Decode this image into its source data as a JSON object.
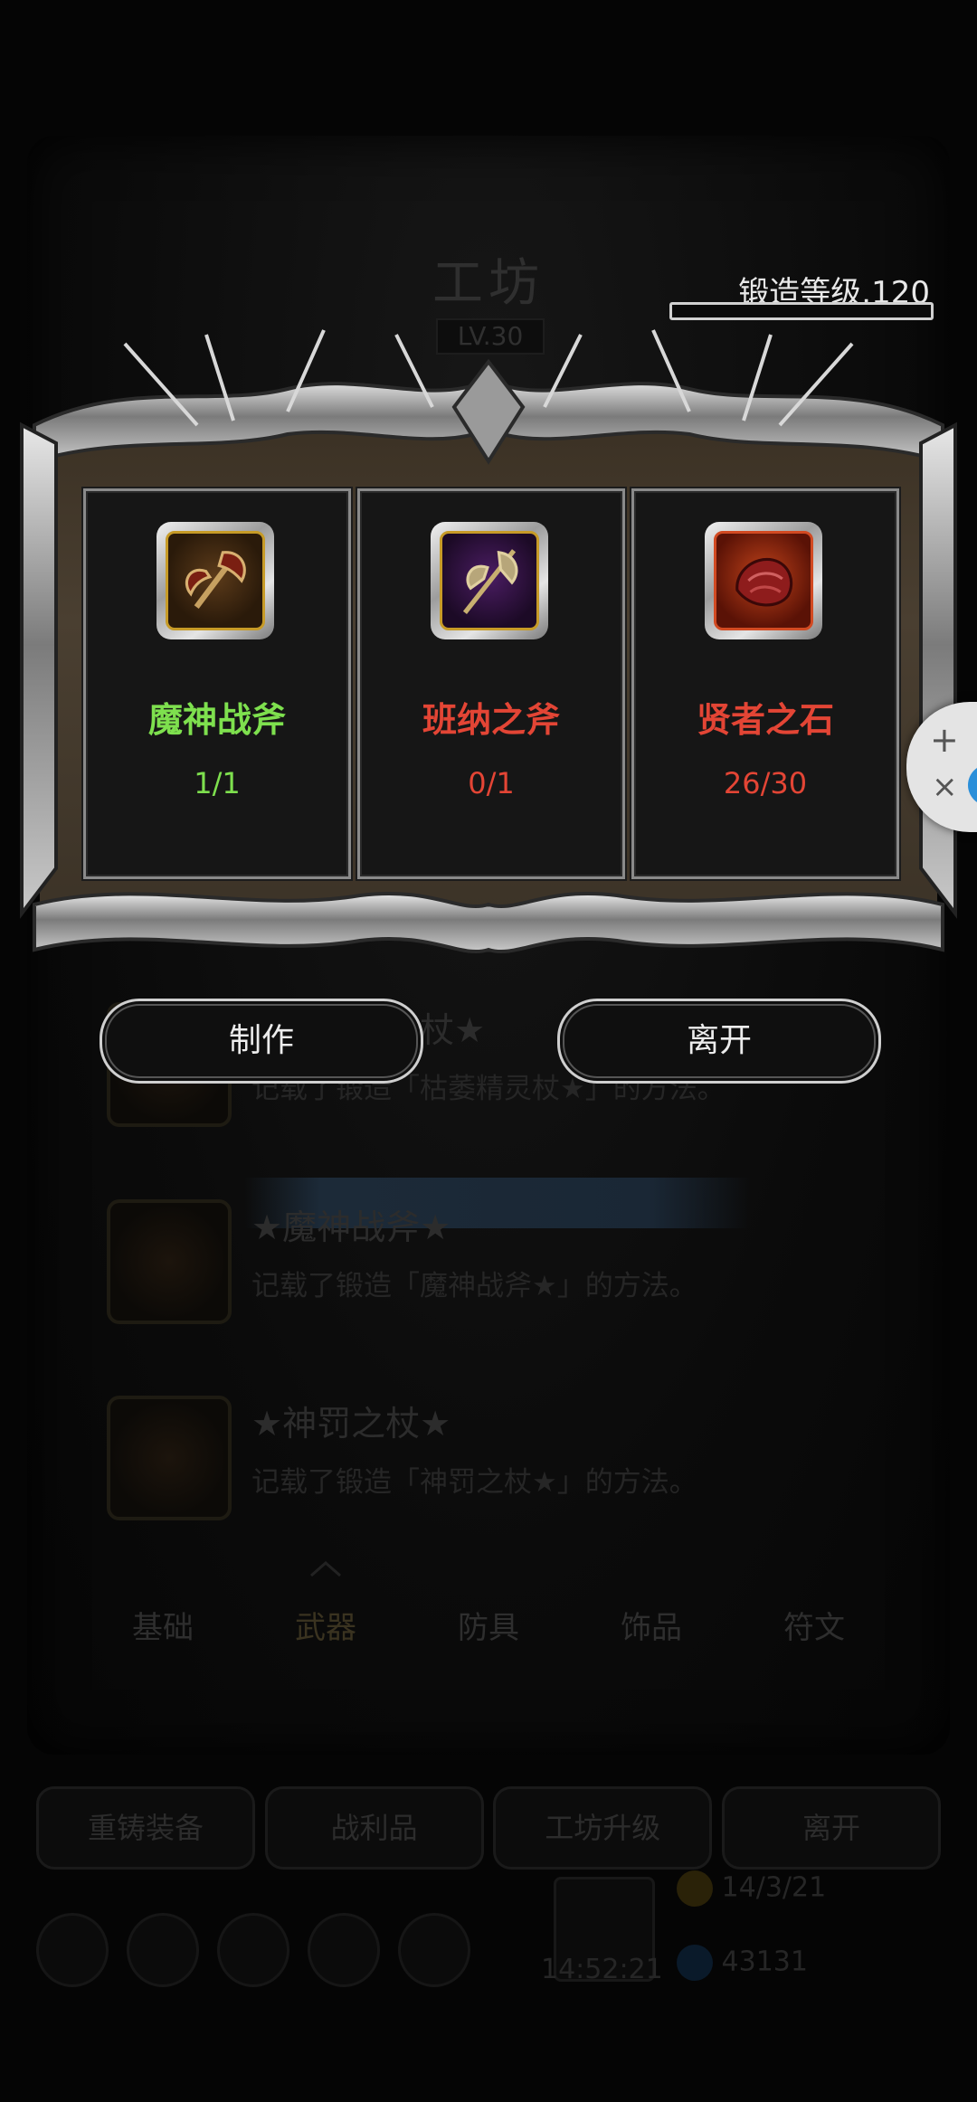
{
  "workshop": {
    "title": "工坊",
    "level": "LV.30",
    "forge_level_label": "锻造等级.120"
  },
  "recipe_list": [
    {
      "title": "★枯萎精灵杖★",
      "desc": "记载了锻造「枯萎精灵杖★」的方法。"
    },
    {
      "title": "★魔神战斧★",
      "desc": "记载了锻造「魔神战斧★」的方法。"
    },
    {
      "title": "★神罚之杖★",
      "desc": "记载了锻造「神罚之杖★」的方法。"
    }
  ],
  "tabs": [
    "基础",
    "武器",
    "防具",
    "饰品",
    "符文"
  ],
  "active_tab": "武器",
  "bottom_buttons": [
    "重铸装备",
    "战利品",
    "工坊升级",
    "离开"
  ],
  "bottom_status": {
    "timer": "14:52:21",
    "resource_1": "14/3/21",
    "resource_2": "43131"
  },
  "materials": [
    {
      "name": "魔神战斧",
      "count": "1/1",
      "status": "enough",
      "icon": "battle-axe-icon"
    },
    {
      "name": "班纳之斧",
      "count": "0/1",
      "status": "missing",
      "icon": "halberd-icon"
    },
    {
      "name": "贤者之石",
      "count": "26/30",
      "status": "missing",
      "icon": "red-stone-icon"
    }
  ],
  "actions": {
    "craft": "制作",
    "leave": "离开"
  },
  "colors": {
    "enough": "#7ee04e",
    "missing": "#e34535",
    "panel": "#4a3f31"
  }
}
